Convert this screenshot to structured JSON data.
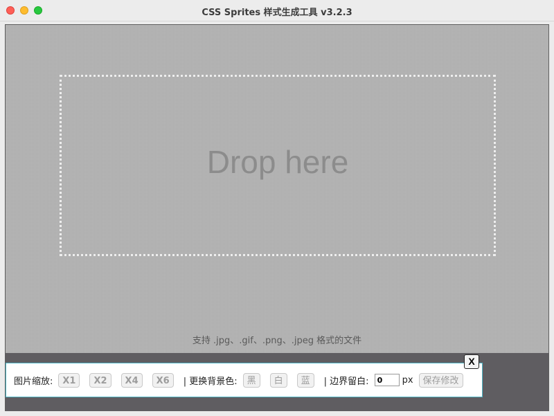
{
  "window": {
    "title": "CSS Sprites 样式生成工具 v3.2.3"
  },
  "dropzone": {
    "text": "Drop here",
    "hint": "支持 .jpg、.gif、.png、.jpeg 格式的文件"
  },
  "toolbar": {
    "zoom_label": "图片缩放:",
    "zoom_buttons": [
      "X1",
      "X2",
      "X4",
      "X6"
    ],
    "bg_label": "| 更换背景色:",
    "bg_buttons": [
      "黑",
      "白",
      "蓝"
    ],
    "margin_label": "| 边界留白:",
    "margin_value": "0",
    "margin_unit": "px",
    "save_label": "保存修改",
    "close_label": "X"
  }
}
